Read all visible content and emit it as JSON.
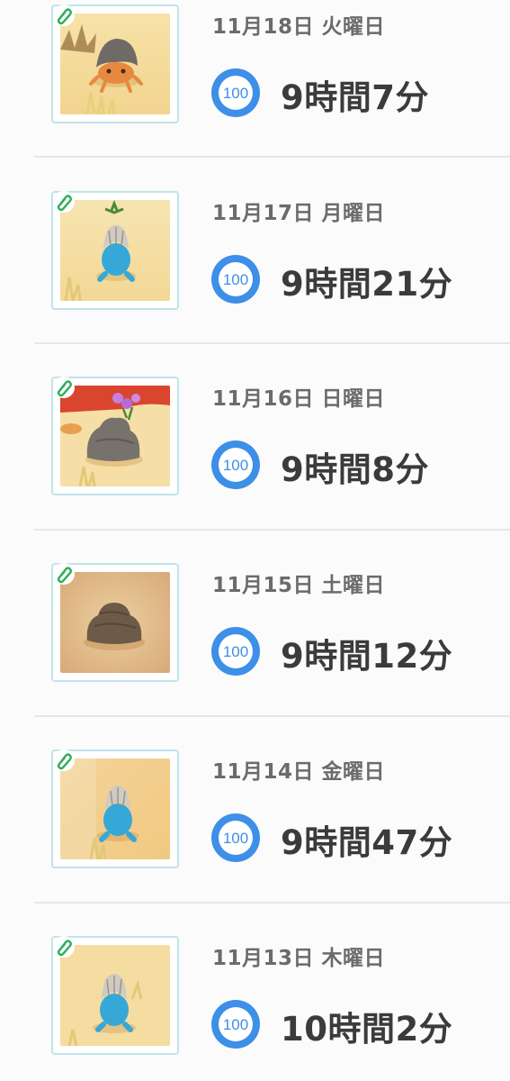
{
  "entries": [
    {
      "date": "11月18日 火曜日",
      "badge": "100",
      "duration": "9時間7分"
    },
    {
      "date": "11月17日 月曜日",
      "badge": "100",
      "duration": "9時間21分"
    },
    {
      "date": "11月16日 日曜日",
      "badge": "100",
      "duration": "9時間8分"
    },
    {
      "date": "11月15日 土曜日",
      "badge": "100",
      "duration": "9時間12分"
    },
    {
      "date": "11月14日 金曜日",
      "badge": "100",
      "duration": "9時間47分"
    },
    {
      "date": "11月13日 木曜日",
      "badge": "100",
      "duration": "10時間2分"
    }
  ],
  "colors": {
    "badge_ring": "#3d8fe8",
    "clip_green": "#2fae5a",
    "frame_border": "#bfe4ea",
    "duration_text": "#3b3b3b",
    "date_text": "#6b6b6b"
  }
}
